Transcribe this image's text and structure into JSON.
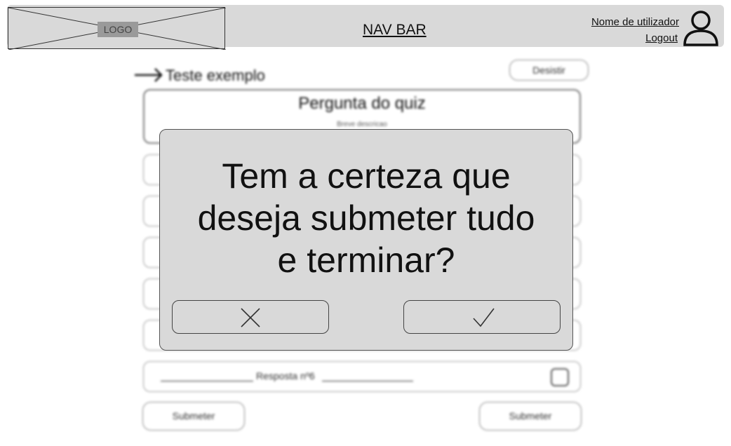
{
  "navbar": {
    "logo": "LOGO",
    "title": "NAV BAR",
    "user_name": "Nome de utilizador",
    "logout": "Logout"
  },
  "quiz": {
    "title": "Teste exemplo",
    "giveup_label": "Desistir",
    "question_title": "Pergunta do quiz",
    "question_description": "Breve descricao",
    "visible_answer": "Resposta nº6",
    "submit_left": "Submeter",
    "submit_right": "Submeter"
  },
  "modal": {
    "line1": "Tem a certeza que",
    "line2": "deseja submeter tudo",
    "line3": "e terminar?",
    "cancel_icon": "close-icon",
    "confirm_icon": "check-icon"
  }
}
